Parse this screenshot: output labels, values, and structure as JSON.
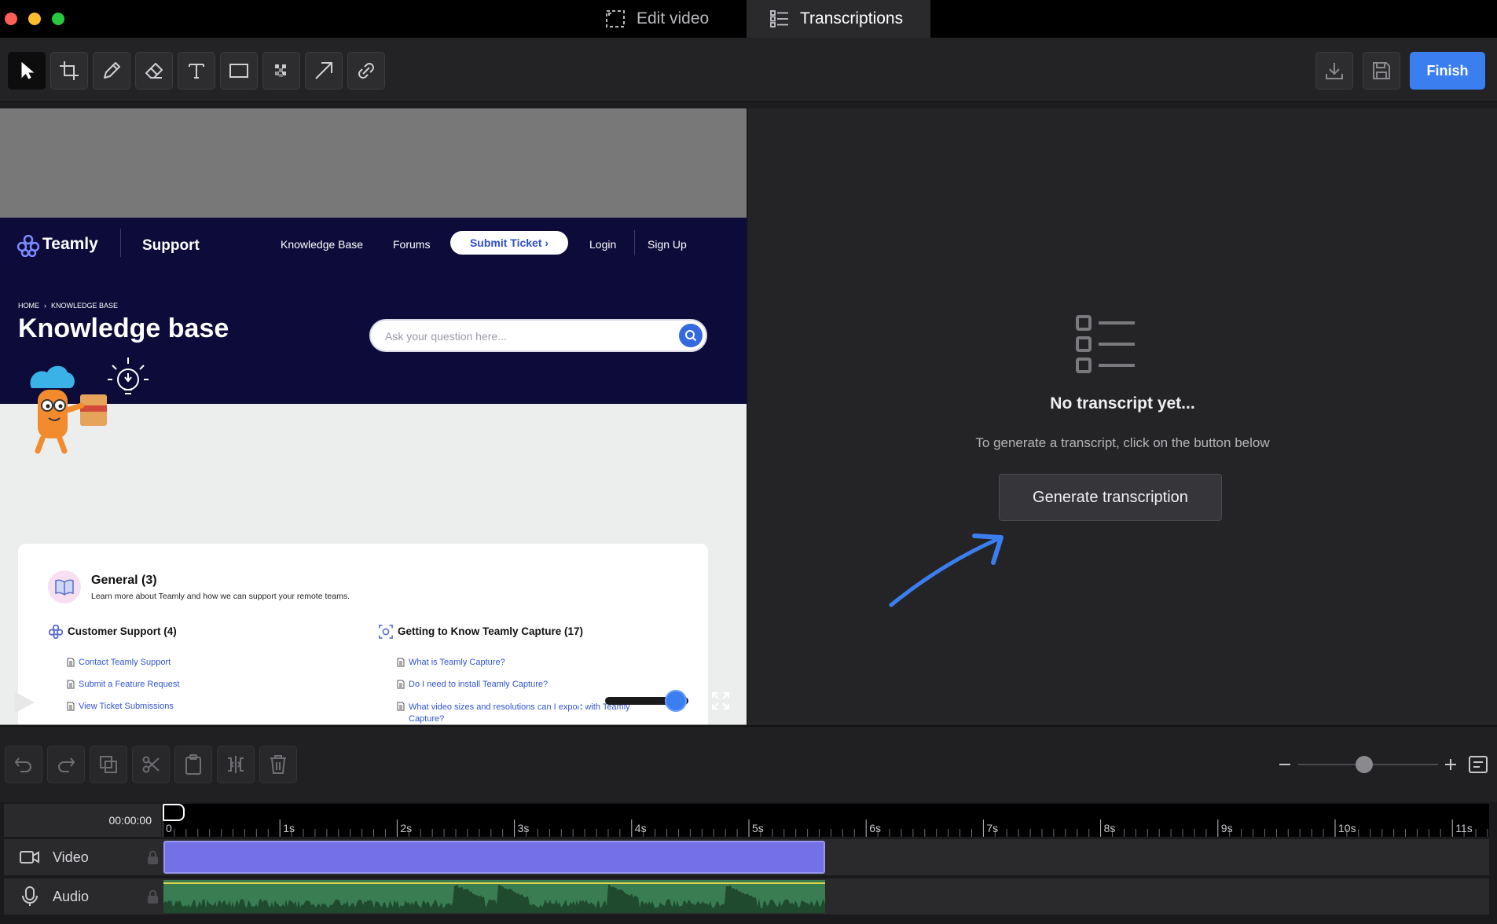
{
  "window": {
    "tabs": [
      {
        "label": "Edit video",
        "active": false
      },
      {
        "label": "Transcriptions",
        "active": true
      }
    ]
  },
  "toolbar": {
    "tools": [
      "select-icon",
      "crop-icon",
      "pencil-icon",
      "eraser-icon",
      "text-icon",
      "rectangle-icon",
      "blur-icon",
      "arrow-icon",
      "link-icon"
    ],
    "finish_label": "Finish",
    "accent": "#3b7ef0"
  },
  "site": {
    "brand": "Teamly",
    "section": "Support",
    "nav": {
      "knowledge_base": "Knowledge Base",
      "forums": "Forums",
      "submit": "Submit Ticket ›",
      "login": "Login",
      "signup": "Sign Up"
    },
    "breadcrumb": {
      "home": "HOME",
      "sep": "›",
      "current": "KNOWLEDGE BASE"
    },
    "title": "Knowledge base",
    "search_placeholder": "Ask your question here...",
    "general": {
      "title": "General (3)",
      "desc": "Learn more about Teamly and how we can support your remote teams."
    },
    "col1": {
      "title": "Customer Support (4)",
      "links": [
        "Contact Teamly Support",
        "Submit a Feature Request",
        "View Ticket Submissions"
      ]
    },
    "col2": {
      "title": "Getting to Know Teamly Capture (17)",
      "links": [
        "What is Teamly Capture?",
        "Do I need to install Teamly Capture?",
        "What video sizes and resolutions can I export with Teamly",
        "Capture?"
      ]
    }
  },
  "player": {
    "volume": 0.85
  },
  "transcript": {
    "empty_title": "No transcript yet...",
    "hint": "To generate a transcript, click on the button below",
    "button": "Generate transcription",
    "arrow_color": "#3b7ef0"
  },
  "zoom": {
    "level": 0.47
  },
  "timeline": {
    "time": "00:00:00",
    "ticks": [
      "0",
      "1s",
      "2s",
      "3s",
      "4s",
      "5s",
      "6s",
      "7s",
      "8s",
      "9s",
      "10s",
      "11s"
    ],
    "tracks": [
      {
        "label": "Video",
        "color": "#7470e6"
      },
      {
        "label": "Audio",
        "color": "#3a7d52"
      }
    ]
  }
}
